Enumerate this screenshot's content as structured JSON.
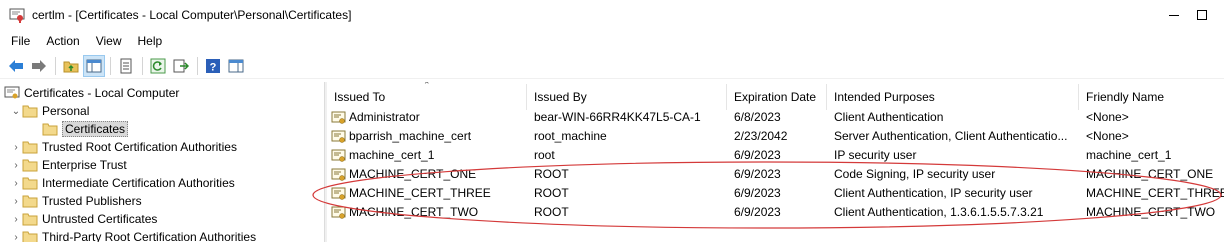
{
  "window": {
    "title": "certlm - [Certificates - Local Computer\\Personal\\Certificates]",
    "app_icon": "certificate-console-icon"
  },
  "menu": [
    {
      "label": "File"
    },
    {
      "label": "Action"
    },
    {
      "label": "View"
    },
    {
      "label": "Help"
    }
  ],
  "toolbar": {
    "buttons": [
      "back-icon",
      "forward-icon",
      "up-folder-icon",
      "show-hide-tree-icon",
      "properties-icon",
      "refresh-icon",
      "export-list-icon",
      "help-icon",
      "show-action-pane-icon"
    ]
  },
  "tree": {
    "root": "Certificates - Local Computer",
    "items": [
      {
        "label": "Personal",
        "expanded": true
      },
      {
        "label": "Certificates",
        "selected": true
      },
      {
        "label": "Trusted Root Certification Authorities"
      },
      {
        "label": "Enterprise Trust"
      },
      {
        "label": "Intermediate Certification Authorities"
      },
      {
        "label": "Trusted Publishers"
      },
      {
        "label": "Untrusted Certificates"
      },
      {
        "label": "Third-Party Root Certification Authorities"
      }
    ]
  },
  "list": {
    "columns": [
      "Issued To",
      "Issued By",
      "Expiration Date",
      "Intended Purposes",
      "Friendly Name"
    ],
    "rows": [
      {
        "issued_to": "Administrator",
        "issued_by": "bear-WIN-66RR4KK47L5-CA-1",
        "expires": "6/8/2023",
        "purposes": "Client Authentication",
        "friendly": "<None>"
      },
      {
        "issued_to": "bparrish_machine_cert",
        "issued_by": "root_machine",
        "expires": "2/23/2042",
        "purposes": "Server Authentication, Client Authenticatio...",
        "friendly": "<None>"
      },
      {
        "issued_to": "machine_cert_1",
        "issued_by": "root",
        "expires": "6/9/2023",
        "purposes": "IP security user",
        "friendly": "machine_cert_1"
      },
      {
        "issued_to": "MACHINE_CERT_ONE",
        "issued_by": "ROOT",
        "expires": "6/9/2023",
        "purposes": "Code Signing, IP security user",
        "friendly": "MACHINE_CERT_ONE"
      },
      {
        "issued_to": "MACHINE_CERT_THREE",
        "issued_by": "ROOT",
        "expires": "6/9/2023",
        "purposes": "Client Authentication, IP security user",
        "friendly": "MACHINE_CERT_THREE"
      },
      {
        "issued_to": "MACHINE_CERT_TWO",
        "issued_by": "ROOT",
        "expires": "6/9/2023",
        "purposes": "Client Authentication, 1.3.6.1.5.5.7.3.21",
        "friendly": "MACHINE_CERT_TWO"
      }
    ]
  },
  "annotation": {
    "color": "#d43a3a"
  },
  "colors": {
    "selection": "#d9d9d9",
    "pressed": "#cce4f7",
    "nav_arrow": "#2b7fd6",
    "folder": "#e8c25a"
  }
}
